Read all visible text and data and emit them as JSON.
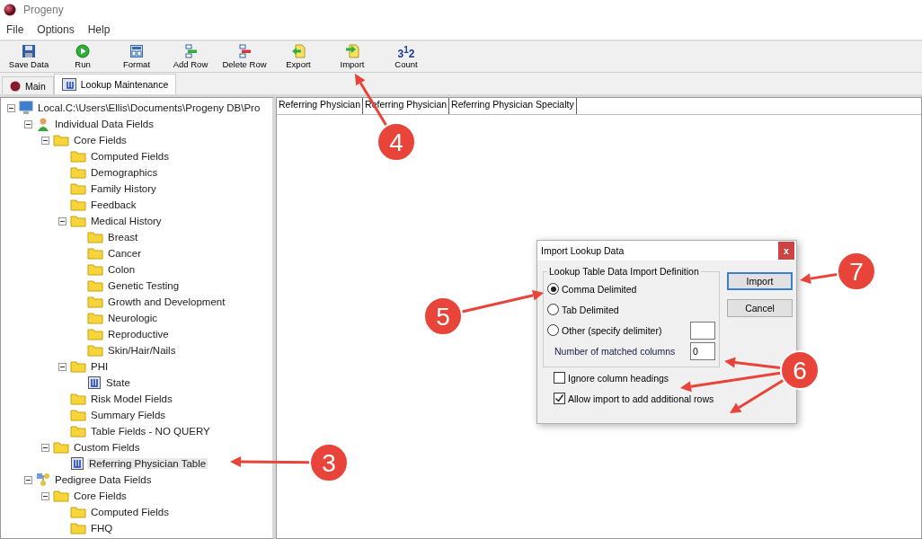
{
  "window": {
    "title": "Progeny"
  },
  "menu": [
    "File",
    "Options",
    "Help"
  ],
  "toolbar": [
    {
      "kind": "save",
      "label": "Save Data"
    },
    {
      "kind": "run",
      "label": "Run"
    },
    {
      "kind": "format",
      "label": "Format"
    },
    {
      "kind": "add",
      "label": "Add Row"
    },
    {
      "kind": "delete",
      "label": "Delete Row"
    },
    {
      "kind": "export",
      "label": "Export"
    },
    {
      "kind": "import",
      "label": "Import"
    },
    {
      "kind": "count",
      "label": "Count",
      "glyph": "3$^{1}$2"
    }
  ],
  "tabs": [
    {
      "kind": "main",
      "label": "Main",
      "selected": false
    },
    {
      "kind": "lookup",
      "label": "Lookup Maintenance",
      "selected": true
    }
  ],
  "tree": [
    {
      "kind": "computer",
      "label": "Local.C:\\Users\\Ellis\\Documents\\Progeny DB\\Pro",
      "expanded": true,
      "selected": false,
      "children": [
        {
          "kind": "person",
          "label": "Individual Data Fields",
          "expanded": true,
          "selected": false,
          "children": [
            {
              "kind": "folder",
              "label": "Core Fields",
              "expanded": true,
              "selected": false,
              "children": [
                {
                  "kind": "folder",
                  "label": "Computed Fields",
                  "selected": false
                },
                {
                  "kind": "folder",
                  "label": "Demographics",
                  "selected": false
                },
                {
                  "kind": "folder",
                  "label": "Family History",
                  "selected": false
                },
                {
                  "kind": "folder",
                  "label": "Feedback",
                  "selected": false
                },
                {
                  "kind": "folder",
                  "label": "Medical History",
                  "expanded": true,
                  "selected": false,
                  "children": [
                    {
                      "kind": "folder",
                      "label": "Breast",
                      "selected": false
                    },
                    {
                      "kind": "folder",
                      "label": "Cancer",
                      "selected": false
                    },
                    {
                      "kind": "folder",
                      "label": "Colon",
                      "selected": false
                    },
                    {
                      "kind": "folder",
                      "label": "Genetic Testing",
                      "selected": false
                    },
                    {
                      "kind": "folder",
                      "label": "Growth and Development",
                      "selected": false
                    },
                    {
                      "kind": "folder",
                      "label": "Neurologic",
                      "selected": false
                    },
                    {
                      "kind": "folder",
                      "label": "Reproductive",
                      "selected": false
                    },
                    {
                      "kind": "folder",
                      "label": "Skin/Hair/Nails",
                      "selected": false
                    }
                  ]
                },
                {
                  "kind": "folder",
                  "label": "PHI",
                  "expanded": true,
                  "selected": false,
                  "children": [
                    {
                      "kind": "table",
                      "label": "State",
                      "selected": false
                    }
                  ]
                },
                {
                  "kind": "folder",
                  "label": "Risk Model Fields",
                  "selected": false
                },
                {
                  "kind": "folder",
                  "label": "Summary Fields",
                  "selected": false
                },
                {
                  "kind": "folder",
                  "label": "Table Fields - NO QUERY",
                  "selected": false
                }
              ]
            },
            {
              "kind": "folder",
              "label": "Custom Fields",
              "expanded": true,
              "selected": false,
              "children": [
                {
                  "kind": "table",
                  "label": "Referring Physician Table",
                  "selected": true
                }
              ]
            }
          ]
        },
        {
          "kind": "pedigree",
          "label": "Pedigree Data Fields",
          "expanded": true,
          "selected": false,
          "children": [
            {
              "kind": "folder",
              "label": "Core Fields",
              "expanded": true,
              "selected": false,
              "children": [
                {
                  "kind": "folder",
                  "label": "Computed Fields",
                  "selected": false
                },
                {
                  "kind": "folder",
                  "label": "FHQ",
                  "selected": false
                }
              ]
            }
          ]
        }
      ]
    }
  ],
  "grid": {
    "columns": [
      "Referring Physician",
      "Referring Physician",
      "Referring Physician Specialty"
    ]
  },
  "dialog": {
    "title": "Import Lookup Data",
    "close": "x",
    "group_title": "Lookup Table Data Import Definition",
    "options": [
      {
        "label": "Comma Delimited",
        "selected": true
      },
      {
        "label": "Tab Delimited",
        "selected": false
      },
      {
        "label": "Other (specify delimiter)",
        "selected": false
      }
    ],
    "columns_label": "Number of matched columns",
    "columns_value": "0",
    "checks": [
      {
        "label": "Ignore column headings",
        "checked": false
      },
      {
        "label": "Allow import to add additional rows",
        "checked": true
      }
    ],
    "buttons": [
      {
        "label": "Import",
        "selected": true
      },
      {
        "label": "Cancel",
        "selected": false
      }
    ]
  },
  "callouts": [
    {
      "label": "4"
    },
    {
      "label": "7"
    },
    {
      "label": "5"
    },
    {
      "label": "6"
    },
    {
      "label": "3"
    }
  ]
}
